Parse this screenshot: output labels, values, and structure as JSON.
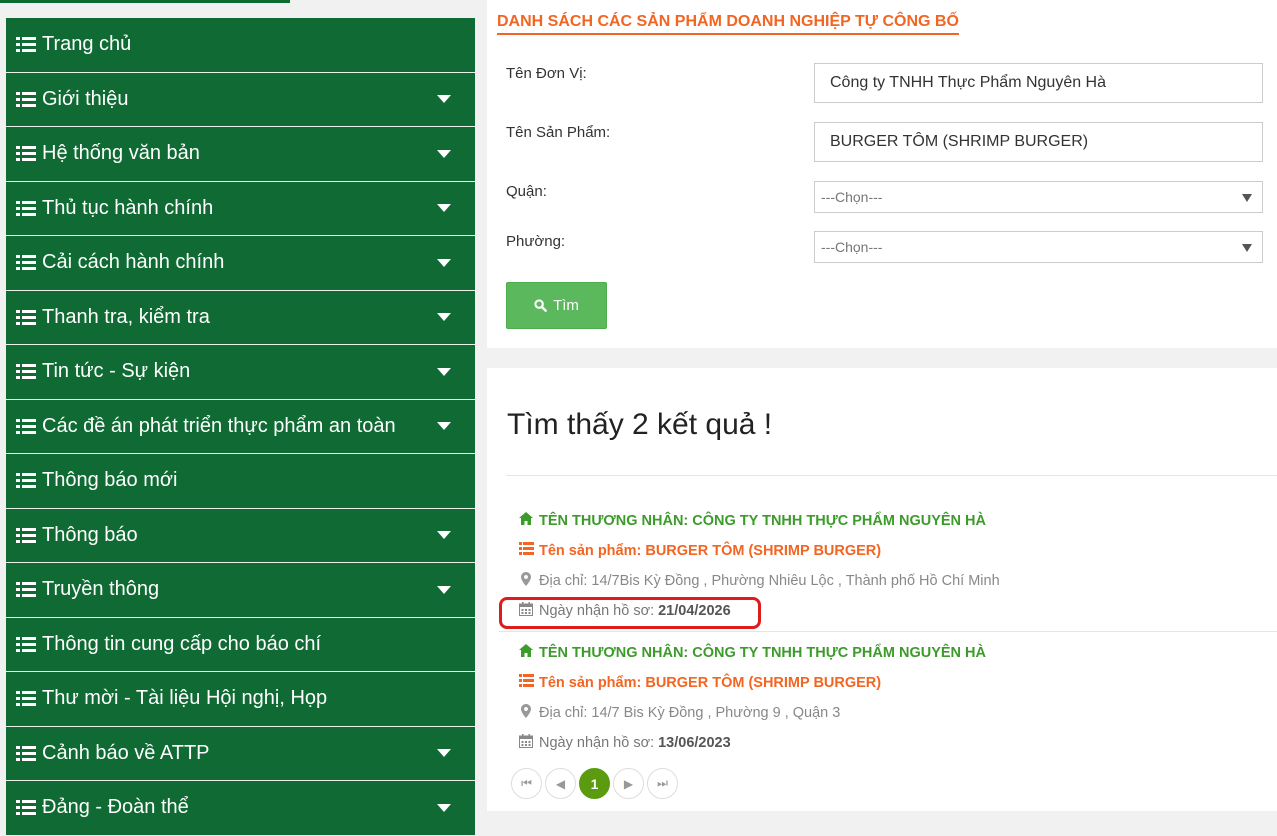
{
  "sidebar": {
    "items": [
      {
        "label": "Trang chủ",
        "has_submenu": false
      },
      {
        "label": "Giới thiệu",
        "has_submenu": true
      },
      {
        "label": "Hệ thống văn bản",
        "has_submenu": true
      },
      {
        "label": "Thủ tục hành chính",
        "has_submenu": true
      },
      {
        "label": "Cải cách hành chính",
        "has_submenu": true
      },
      {
        "label": "Thanh tra, kiểm tra",
        "has_submenu": true
      },
      {
        "label": "Tin tức - Sự kiện",
        "has_submenu": true
      },
      {
        "label": "Các đề án phát triển thực phẩm an toàn",
        "has_submenu": true
      },
      {
        "label": "Thông báo mới",
        "has_submenu": false
      },
      {
        "label": "Thông báo",
        "has_submenu": true
      },
      {
        "label": "Truyền thông",
        "has_submenu": true
      },
      {
        "label": "Thông tin cung cấp cho báo chí",
        "has_submenu": false
      },
      {
        "label": "Thư mời - Tài liệu Hội nghị, Họp",
        "has_submenu": false
      },
      {
        "label": "Cảnh báo về ATTP",
        "has_submenu": true
      },
      {
        "label": "Đảng - Đoàn thể",
        "has_submenu": true
      }
    ]
  },
  "search": {
    "heading": "DANH SÁCH CÁC SẢN PHẨM DOANH NGHIỆP TỰ CÔNG BỐ",
    "unit_label": "Tên Đơn Vị:",
    "unit_value": "Công ty TNHH Thực Phẩm Nguyên Hà",
    "product_label": "Tên Sản Phẩm:",
    "product_value": "BURGER TÔM (SHRIMP BURGER)",
    "district_label": "Quận:",
    "district_value": "---Chọn---",
    "ward_label": "Phường:",
    "ward_value": "---Chọn---",
    "button_label": "Tìm"
  },
  "results": {
    "count_text": "Tìm thấy 2 kết quả !",
    "items": [
      {
        "merchant": "TÊN THƯƠNG NHÂN: CÔNG TY TNHH THỰC PHẨM NGUYÊN HÀ",
        "product": "Tên sản phẩm: BURGER TÔM (SHRIMP BURGER)",
        "address": "Địa chỉ: 14/7Bis Kỳ Đồng , Phường Nhiêu Lộc , Thành phố Hồ Chí Minh",
        "date_label": "Ngày nhận hồ sơ:",
        "date_value": "21/04/2026"
      },
      {
        "merchant": "TÊN THƯƠNG NHÂN: CÔNG TY TNHH THỰC PHẨM NGUYÊN HÀ",
        "product": "Tên sản phẩm: BURGER TÔM (SHRIMP BURGER)",
        "address": "Địa chỉ: 14/7 Bis Kỳ Đồng , Phường 9 , Quận 3",
        "date_label": "Ngày nhận hồ sơ:",
        "date_value": "13/06/2023"
      }
    ]
  },
  "pagination": {
    "first": "⏮",
    "prev": "◀",
    "current": "1",
    "next": "▶",
    "last": "⏭"
  },
  "colors": {
    "sidebar_bg": "#0f6b33",
    "heading": "#f26522",
    "merchant": "#3c9b2a",
    "button": "#5cb85c",
    "highlight": "#dd1c1c"
  }
}
